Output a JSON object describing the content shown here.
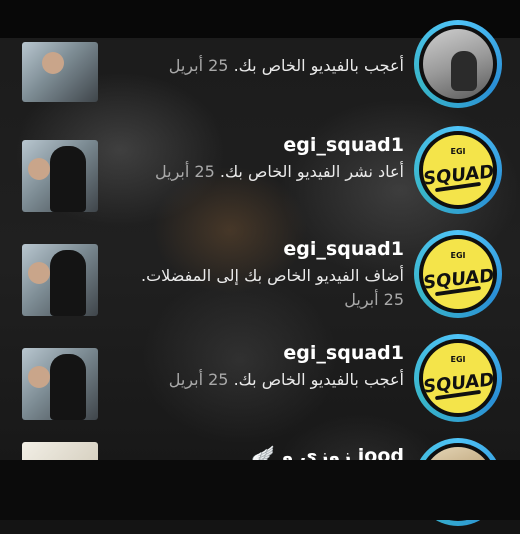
{
  "notifications": [
    {
      "username": "",
      "message": "أعجب بالفيديو الخاص بك.",
      "date": "25 أبريل",
      "avatar_type": "photo"
    },
    {
      "username": "egi_squad1",
      "message": "أعاد نشر الفيديو الخاص بك.",
      "date": "25 أبريل",
      "avatar_type": "squad-logo",
      "logo_text": "SQUAD",
      "logo_sub": "EGI"
    },
    {
      "username": "egi_squad1",
      "message": "أضاف الفيديو الخاص بك إلى المفضلات.",
      "date": "25 أبريل",
      "avatar_type": "squad-logo",
      "logo_text": "SQUAD",
      "logo_sub": "EGI"
    },
    {
      "username": "egi_squad1",
      "message": "أعجب بالفيديو الخاص بك.",
      "date": "25 أبريل",
      "avatar_type": "squad-logo",
      "logo_text": "SQUAD",
      "logo_sub": "EGI"
    },
    {
      "username": "زوزي و jood",
      "username_emoji": "🪽",
      "message": "",
      "date": "",
      "avatar_type": "photo"
    }
  ],
  "colors": {
    "ring": "#4fc3f7",
    "logo_bg": "#f4e44a",
    "date": "#a9a9a9"
  }
}
